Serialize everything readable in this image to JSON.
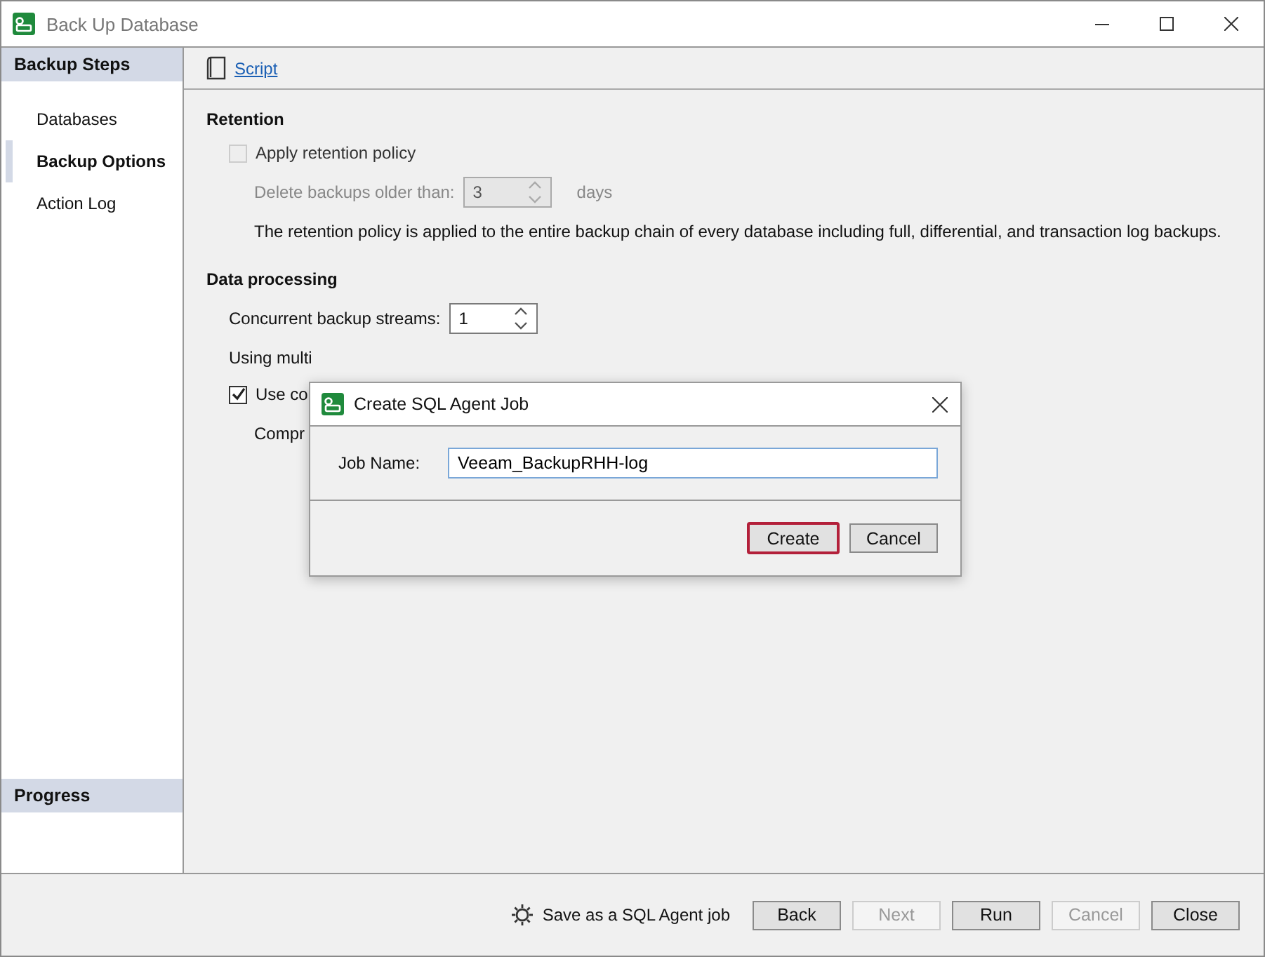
{
  "window": {
    "title": "Back Up Database"
  },
  "sidebar": {
    "header": "Backup Steps",
    "items": [
      {
        "label": "Databases",
        "selected": false
      },
      {
        "label": "Backup Options",
        "selected": true
      },
      {
        "label": "Action Log",
        "selected": false
      }
    ],
    "progress_header": "Progress"
  },
  "toolbar": {
    "script_link": "Script"
  },
  "retention": {
    "heading": "Retention",
    "apply_policy": {
      "label": "Apply retention policy",
      "checked": false,
      "disabled": true
    },
    "delete_label": "Delete backups older than:",
    "delete_value": "3",
    "delete_unit": "days",
    "note": "The retention policy is applied to the entire backup chain of every database including full, differential, and transaction log backups."
  },
  "data_processing": {
    "heading": "Data processing",
    "streams_label": "Concurrent backup streams:",
    "streams_value": "1",
    "streams_note": "Using multi",
    "compression": {
      "label": "Use co",
      "checked": true
    },
    "compression_level_label": "Compr"
  },
  "dialog": {
    "title": "Create SQL Agent Job",
    "job_name_label": "Job Name:",
    "job_name_value": "Veeam_BackupRHH-log",
    "buttons": [
      {
        "label": "Create",
        "focused": true
      },
      {
        "label": "Cancel",
        "focused": false
      }
    ]
  },
  "footer": {
    "save_job": "Save as a SQL Agent job",
    "buttons": [
      {
        "label": "Back",
        "disabled": false
      },
      {
        "label": "Next",
        "disabled": true
      },
      {
        "label": "Run",
        "disabled": false
      },
      {
        "label": "Cancel",
        "disabled": true
      },
      {
        "label": "Close",
        "disabled": false
      }
    ]
  }
}
